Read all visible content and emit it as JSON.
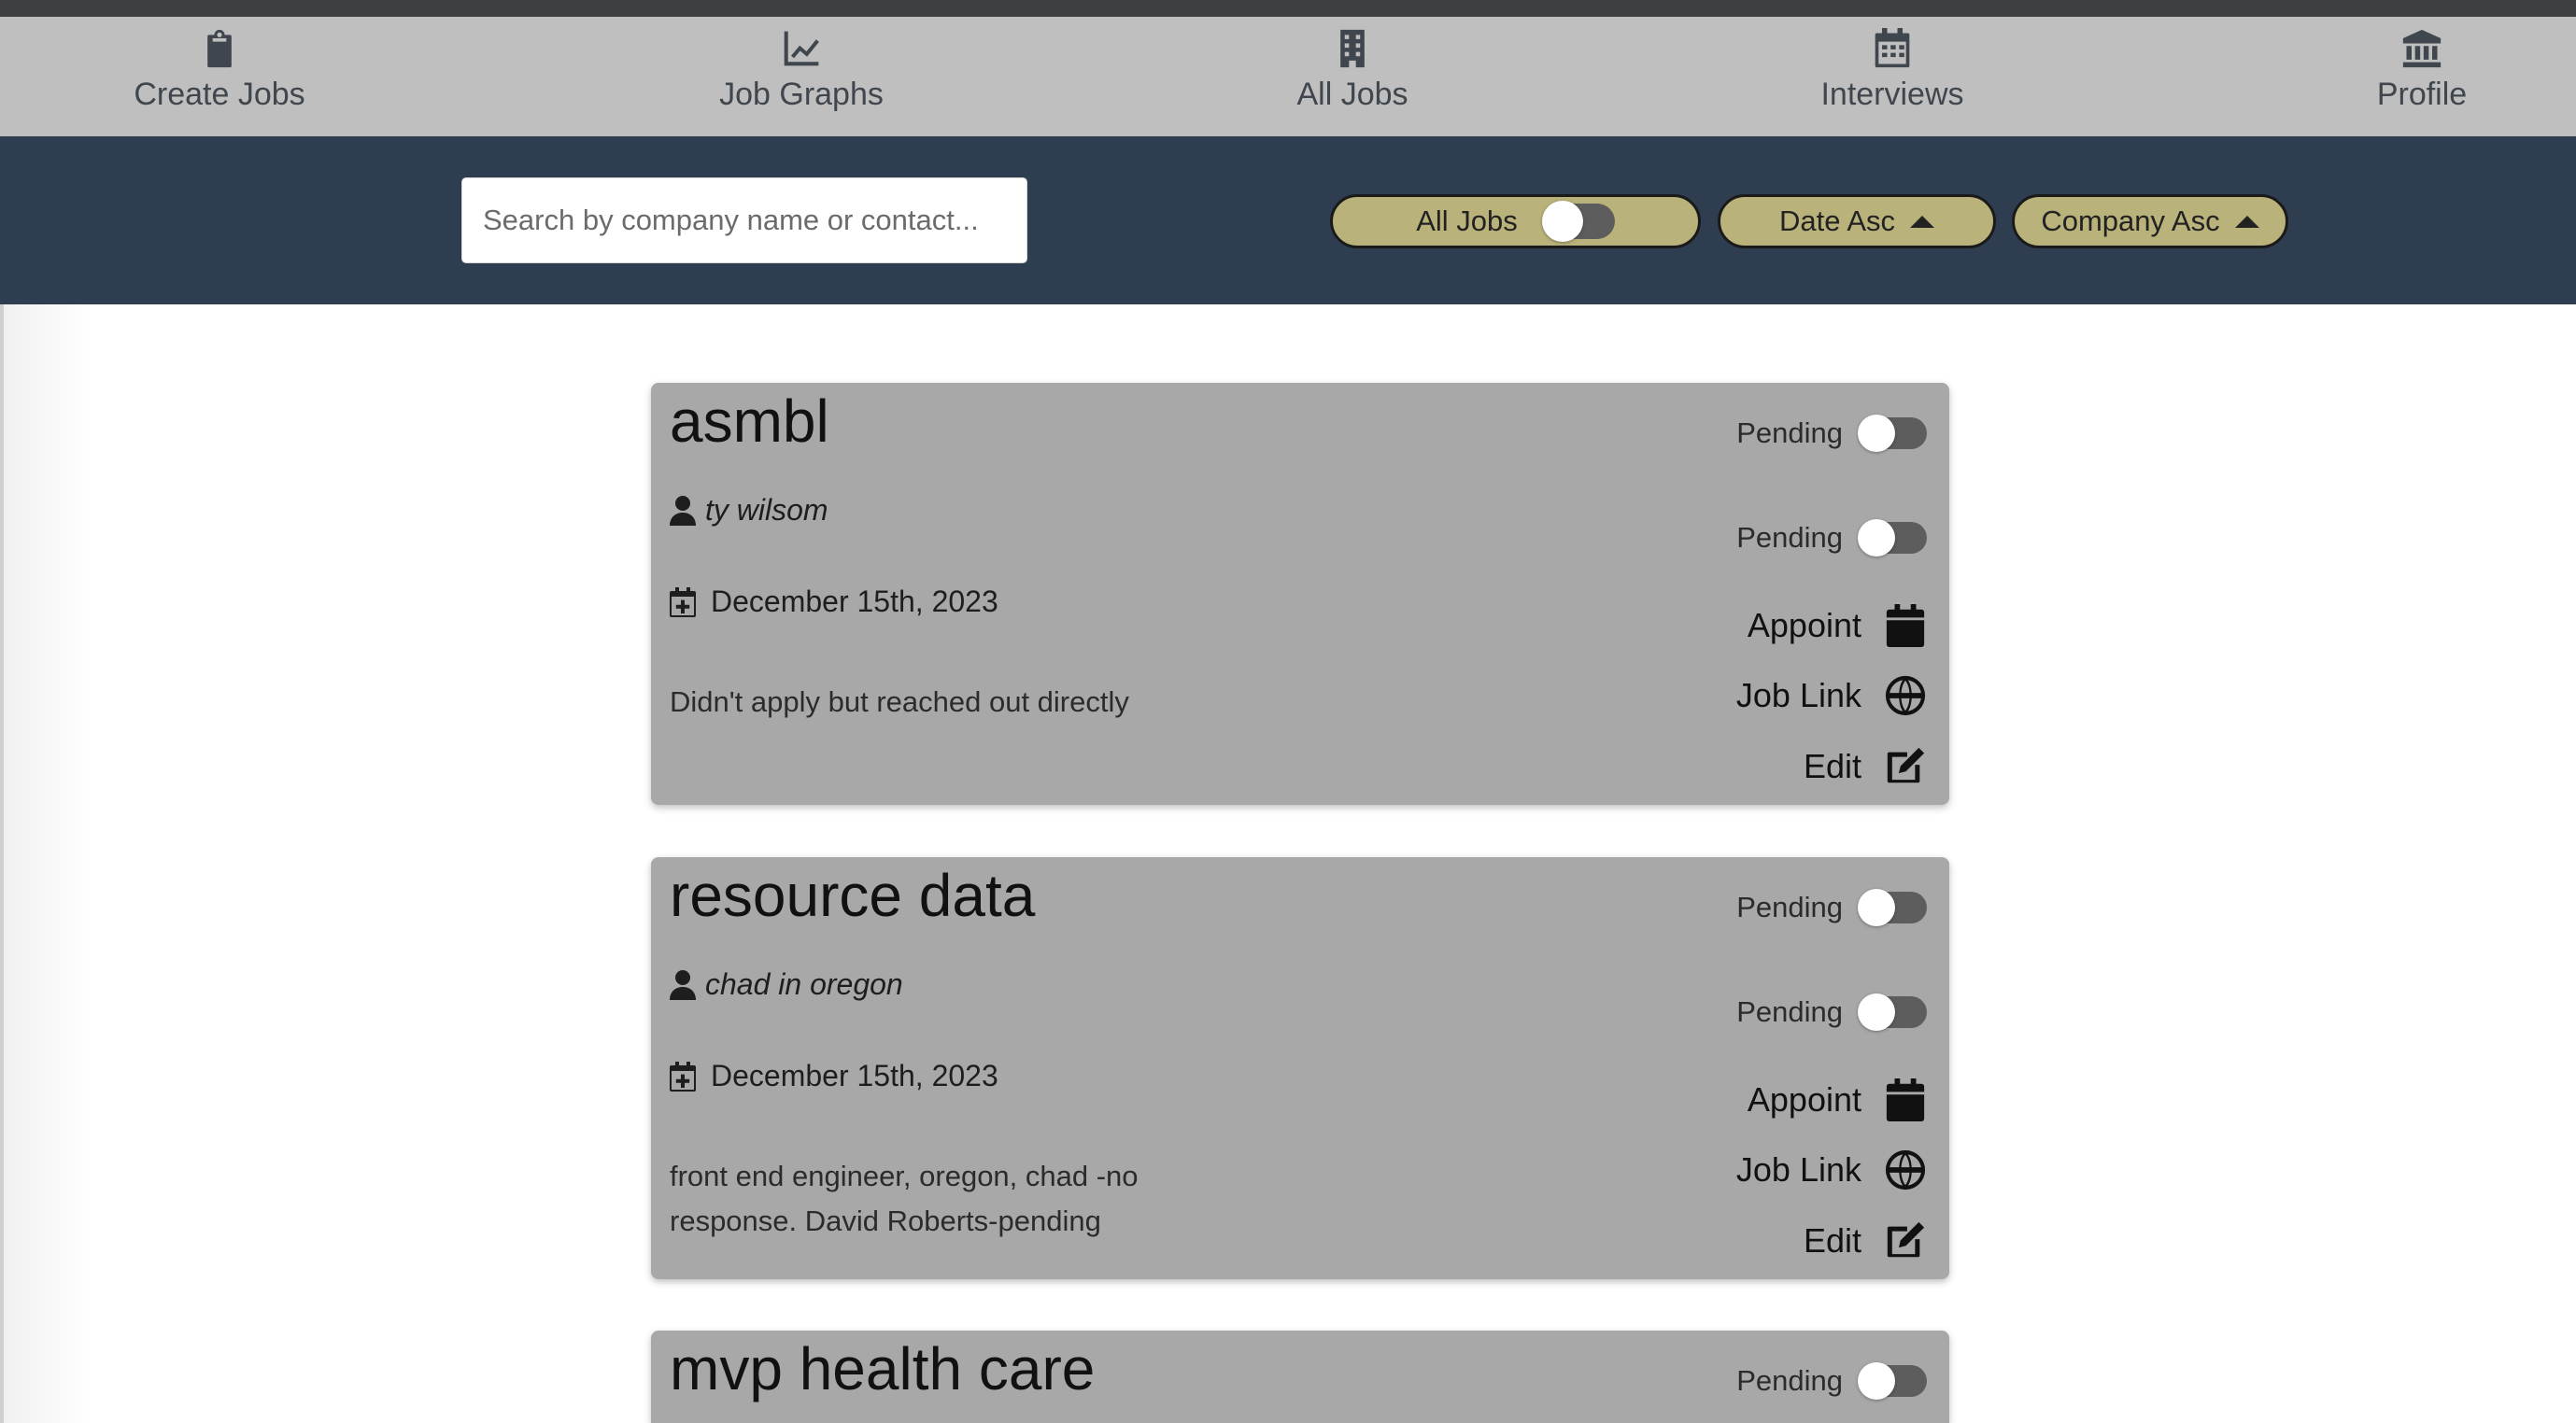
{
  "nav": {
    "items": [
      {
        "label": "Create Jobs",
        "icon": "clipboard-icon"
      },
      {
        "label": "Job Graphs",
        "icon": "chart-line-icon"
      },
      {
        "label": "All Jobs",
        "icon": "building-icon"
      },
      {
        "label": "Interviews",
        "icon": "calendar-icon"
      },
      {
        "label": "Profile",
        "icon": "bank-icon"
      }
    ]
  },
  "filters": {
    "search_placeholder": "Search by company name or contact...",
    "all_jobs_label": "All Jobs",
    "all_jobs_toggle_on": false,
    "date_sort_label": "Date Asc",
    "company_sort_label": "Company Asc"
  },
  "colors": {
    "nav_bg": "#bfbfbf",
    "filter_bar_bg": "#2e3d4f",
    "pill_bg": "#b9b27a",
    "card_bg": "#a8a8a8"
  },
  "jobs": [
    {
      "company": "asmbl",
      "contact": "ty wilsom",
      "date": "December 15th, 2023",
      "notes": "Didn't apply but reached out directly",
      "status_1": "Pending",
      "status_2": "Pending",
      "appoint_label": "Appoint",
      "job_link_label": "Job Link",
      "edit_label": "Edit"
    },
    {
      "company": "resource data",
      "contact": "chad in oregon",
      "date": "December 15th, 2023",
      "notes": "front end engineer, oregon, chad -no response. David Roberts-pending",
      "status_1": "Pending",
      "status_2": "Pending",
      "appoint_label": "Appoint",
      "job_link_label": "Job Link",
      "edit_label": "Edit"
    },
    {
      "company": "mvp health care",
      "status_1": "Pending"
    }
  ]
}
